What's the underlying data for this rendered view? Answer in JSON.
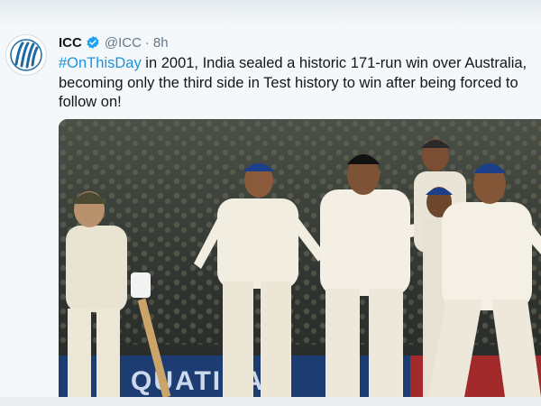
{
  "tweet": {
    "author_name": "ICC",
    "handle": "@ICC",
    "separator": "·",
    "time": "8h",
    "hashtag": "#OnThisDay",
    "body": " in 2001, India sealed a historic 171-run win over Australia, becoming only the third side in Test history to win after being forced to follow on!"
  },
  "photo": {
    "banner_text": "QUATINA"
  },
  "colors": {
    "link": "#1b95e0",
    "verified": "#1da1f2",
    "logo": "#1b6aa5"
  }
}
